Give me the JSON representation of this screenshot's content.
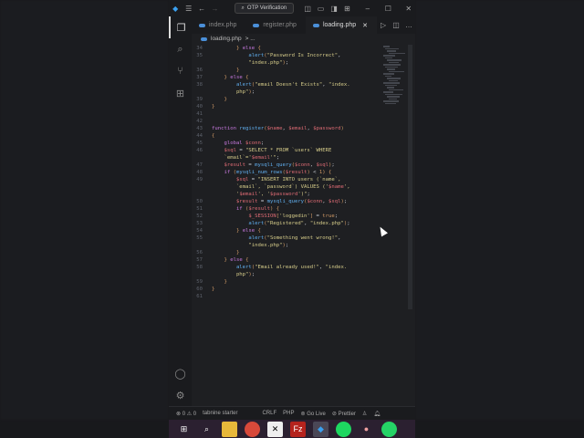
{
  "titlebar": {
    "search": "OTP Verification"
  },
  "tabs": [
    {
      "label": "index.php"
    },
    {
      "label": "register.php"
    },
    {
      "label": "loading.php",
      "active": true
    }
  ],
  "breadcrumb": {
    "file": "loading.php",
    "rest": "> ..."
  },
  "code": [
    {
      "n": "34",
      "t": [
        [
          "pu",
          "        } "
        ],
        [
          "kw",
          "else"
        ],
        [
          "pu",
          " {"
        ]
      ]
    },
    {
      "n": "35",
      "t": [
        [
          "fn",
          "            alert"
        ],
        [
          "pu",
          "("
        ],
        [
          "str",
          "\"Password Is Incorrect\""
        ],
        [
          "pl",
          ","
        ]
      ]
    },
    {
      "n": "",
      "t": [
        [
          "str",
          "            \"index.php\""
        ],
        [
          "pu",
          ")"
        ],
        [
          "pl",
          ";"
        ]
      ]
    },
    {
      "n": "36",
      "t": [
        [
          "pu",
          "        }"
        ]
      ]
    },
    {
      "n": "37",
      "t": [
        [
          "pu",
          "    } "
        ],
        [
          "kw",
          "else"
        ],
        [
          "pu",
          " {"
        ]
      ]
    },
    {
      "n": "38",
      "t": [
        [
          "fn",
          "        alert"
        ],
        [
          "pu",
          "("
        ],
        [
          "str",
          "\"email Doesn't Exists\""
        ],
        [
          "pl",
          ", "
        ],
        [
          "str",
          "\"index."
        ]
      ]
    },
    {
      "n": "",
      "t": [
        [
          "str",
          "        php\""
        ],
        [
          "pu",
          ")"
        ],
        [
          "pl",
          ";"
        ]
      ]
    },
    {
      "n": "39",
      "t": [
        [
          "pu",
          "    }"
        ]
      ]
    },
    {
      "n": "40",
      "t": [
        [
          "pu",
          "}"
        ]
      ]
    },
    {
      "n": "41",
      "t": []
    },
    {
      "n": "42",
      "t": []
    },
    {
      "n": "43",
      "t": [
        [
          "kw",
          "function "
        ],
        [
          "fn",
          "register"
        ],
        [
          "pu",
          "("
        ],
        [
          "var",
          "$name"
        ],
        [
          "pl",
          ", "
        ],
        [
          "var",
          "$email"
        ],
        [
          "pl",
          ", "
        ],
        [
          "var",
          "$password"
        ],
        [
          "pu",
          ")"
        ]
      ]
    },
    {
      "n": "44",
      "t": [
        [
          "pu",
          "{"
        ]
      ]
    },
    {
      "n": "45",
      "t": [
        [
          "kw",
          "    global "
        ],
        [
          "var",
          "$conn"
        ],
        [
          "pl",
          ";"
        ]
      ]
    },
    {
      "n": "46",
      "t": [
        [
          "var",
          "    $sql"
        ],
        [
          "pl",
          " = "
        ],
        [
          "str",
          "\"SELECT * FROM `users` WHERE"
        ]
      ]
    },
    {
      "n": "",
      "t": [
        [
          "str",
          "    `email`='"
        ],
        [
          "var",
          "$email"
        ],
        [
          "str",
          "'\""
        ],
        [
          "pl",
          ";"
        ]
      ]
    },
    {
      "n": "47",
      "t": [
        [
          "var",
          "    $result"
        ],
        [
          "pl",
          " = "
        ],
        [
          "fn",
          "mysqli_query"
        ],
        [
          "pu",
          "("
        ],
        [
          "var",
          "$conn"
        ],
        [
          "pl",
          ", "
        ],
        [
          "var",
          "$sql"
        ],
        [
          "pu",
          ")"
        ],
        [
          "pl",
          ";"
        ]
      ]
    },
    {
      "n": "48",
      "t": [
        [
          "kw",
          "    if "
        ],
        [
          "pu",
          "("
        ],
        [
          "fn",
          "mysqli_num_rows"
        ],
        [
          "pu",
          "("
        ],
        [
          "var",
          "$result"
        ],
        [
          "pu",
          ")"
        ],
        [
          "pl",
          " < "
        ],
        [
          "pu",
          "1"
        ],
        [
          "pu",
          ") {"
        ]
      ]
    },
    {
      "n": "49",
      "t": [
        [
          "var",
          "        $sql"
        ],
        [
          "pl",
          " = "
        ],
        [
          "str",
          "\"INSERT INTO users (`name`,"
        ]
      ]
    },
    {
      "n": "",
      "t": [
        [
          "str",
          "        `email`, `password`) VALUES ('"
        ],
        [
          "var",
          "$name"
        ],
        [
          "str",
          "',"
        ]
      ]
    },
    {
      "n": "",
      "t": [
        [
          "str",
          "        '"
        ],
        [
          "var",
          "$email"
        ],
        [
          "str",
          "', '"
        ],
        [
          "var",
          "$password"
        ],
        [
          "str",
          "')\""
        ],
        [
          "pl",
          ";"
        ]
      ]
    },
    {
      "n": "50",
      "t": [
        [
          "var",
          "        $result"
        ],
        [
          "pl",
          " = "
        ],
        [
          "fn",
          "mysqli_query"
        ],
        [
          "pu",
          "("
        ],
        [
          "var",
          "$conn"
        ],
        [
          "pl",
          ", "
        ],
        [
          "var",
          "$sql"
        ],
        [
          "pu",
          ")"
        ],
        [
          "pl",
          ";"
        ]
      ]
    },
    {
      "n": "51",
      "t": [
        [
          "kw",
          "        if "
        ],
        [
          "pu",
          "("
        ],
        [
          "var",
          "$result"
        ],
        [
          "pu",
          ") {"
        ]
      ]
    },
    {
      "n": "52",
      "t": [
        [
          "var",
          "            $_SESSION"
        ],
        [
          "pu",
          "["
        ],
        [
          "str",
          "'loggedin'"
        ],
        [
          "pu",
          "]"
        ],
        [
          "pl",
          " = "
        ],
        [
          "pu",
          "true"
        ],
        [
          "pl",
          ";"
        ]
      ]
    },
    {
      "n": "53",
      "t": [
        [
          "fn",
          "            alert"
        ],
        [
          "pu",
          "("
        ],
        [
          "str",
          "\"Registered\""
        ],
        [
          "pl",
          ", "
        ],
        [
          "str",
          "\"index.php\""
        ],
        [
          "pu",
          ")"
        ],
        [
          "pl",
          ";"
        ]
      ]
    },
    {
      "n": "54",
      "t": [
        [
          "pu",
          "        } "
        ],
        [
          "kw",
          "else"
        ],
        [
          "pu",
          " {"
        ]
      ]
    },
    {
      "n": "55",
      "t": [
        [
          "fn",
          "            alert"
        ],
        [
          "pu",
          "("
        ],
        [
          "str",
          "\"Something went wrong!\""
        ],
        [
          "pl",
          ","
        ]
      ]
    },
    {
      "n": "",
      "t": [
        [
          "str",
          "            \"index.php\""
        ],
        [
          "pu",
          ")"
        ],
        [
          "pl",
          ";"
        ]
      ]
    },
    {
      "n": "56",
      "t": [
        [
          "pu",
          "        }"
        ]
      ]
    },
    {
      "n": "57",
      "t": [
        [
          "pu",
          "    } "
        ],
        [
          "kw",
          "else"
        ],
        [
          "pu",
          " {"
        ]
      ]
    },
    {
      "n": "58",
      "t": [
        [
          "fn",
          "        alert"
        ],
        [
          "pu",
          "("
        ],
        [
          "str",
          "\"Email already used!\""
        ],
        [
          "pl",
          ", "
        ],
        [
          "str",
          "\"index."
        ]
      ]
    },
    {
      "n": "",
      "t": [
        [
          "str",
          "        php\""
        ],
        [
          "pu",
          ")"
        ],
        [
          "pl",
          ";"
        ]
      ]
    },
    {
      "n": "59",
      "t": [
        [
          "pu",
          "    }"
        ]
      ]
    },
    {
      "n": "60",
      "t": [
        [
          "pu",
          "}"
        ]
      ]
    },
    {
      "n": "61",
      "t": []
    }
  ],
  "status": {
    "errors": "0",
    "warnings": "0",
    "tabnine": "tabnine starter",
    "eol": "CRLF",
    "lang": "PHP",
    "golive": "Go Live",
    "prettier": "Prettier"
  }
}
